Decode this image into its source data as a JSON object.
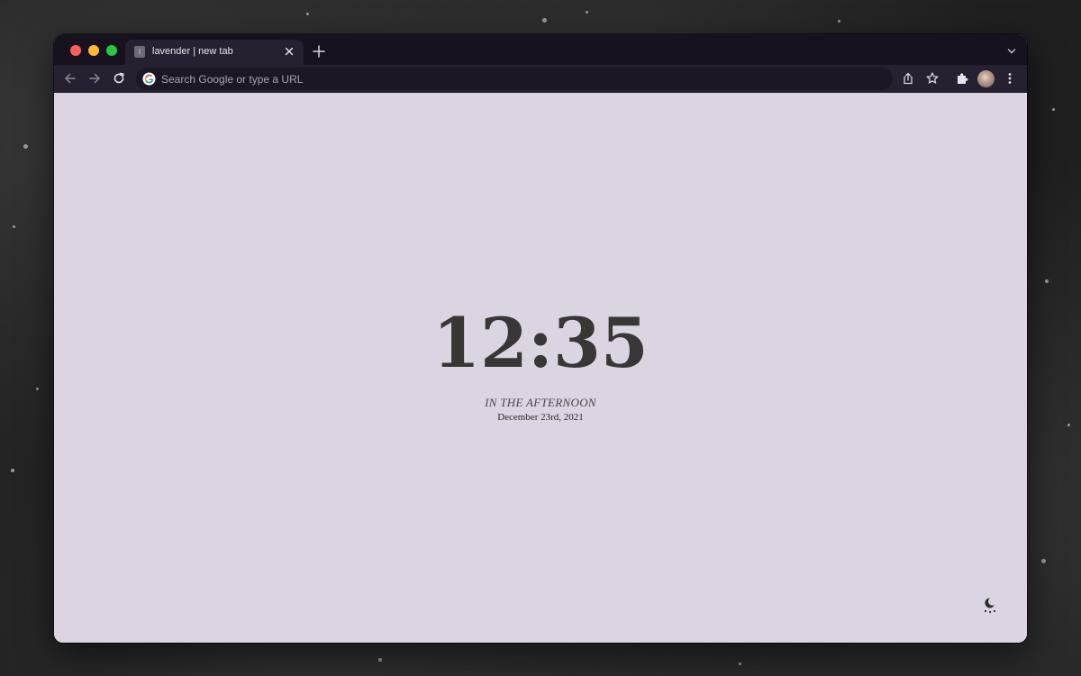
{
  "browser": {
    "tab": {
      "favicon_letter": "l",
      "title": "lavender | new tab"
    },
    "omnibox": {
      "placeholder": "Search Google or type a URL"
    }
  },
  "page": {
    "clock": "12:35",
    "period": "IN THE AFTERNOON",
    "date": "December 23rd, 2021"
  },
  "colors": {
    "page_background": "#dcd5e1",
    "chrome_dark": "#16131f",
    "toolbar": "#262130",
    "clock_text": "#3b3636"
  },
  "icons": {
    "window_controls": [
      "close-dot",
      "minimize-dot",
      "zoom-dot"
    ],
    "toolbar": [
      "back-arrow-icon",
      "forward-arrow-icon",
      "reload-icon",
      "google-icon",
      "share-icon",
      "star-icon",
      "extensions-icon",
      "avatar",
      "more-menu-icon"
    ],
    "page": [
      "moon-theme-icon"
    ]
  }
}
